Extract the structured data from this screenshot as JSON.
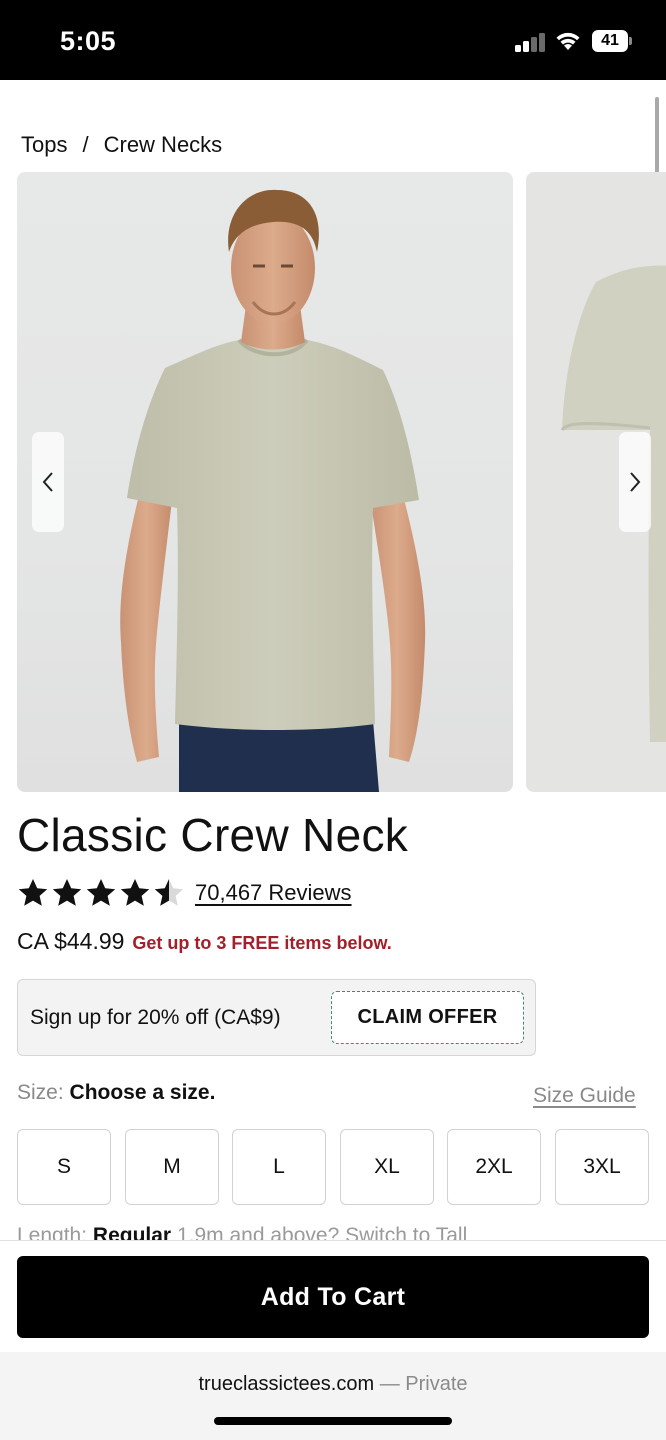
{
  "status_bar": {
    "time": "5:05",
    "battery": "41"
  },
  "breadcrumb": {
    "items": [
      "Tops",
      "Crew Necks"
    ],
    "separator": "/"
  },
  "product": {
    "title": "Classic Crew Neck",
    "rating": 4.5,
    "rating_max": 5,
    "reviews": "70,467 Reviews",
    "price": "CA $44.99",
    "promo": "Get up to 3 FREE items below."
  },
  "offer": {
    "text": "Sign up for 20% off (CA$9)",
    "button": "CLAIM OFFER"
  },
  "size": {
    "label": "Size:",
    "value": "Choose a size.",
    "guide": "Size Guide",
    "options": [
      "S",
      "M",
      "L",
      "XL",
      "2XL",
      "3XL"
    ]
  },
  "length": {
    "label": "Length:",
    "value": "Regular",
    "hint": "1.9m and above? Switch to Tall"
  },
  "cart": {
    "button": "Add To Cart"
  },
  "browser": {
    "domain": "trueclassictees.com",
    "separator": "—",
    "mode": "Private"
  },
  "colors": {
    "promo_red": "#a3202a",
    "claim_border_green": "#3f8a67",
    "cart_black": "#000000",
    "shirt_sage": "#c9c9b6"
  }
}
